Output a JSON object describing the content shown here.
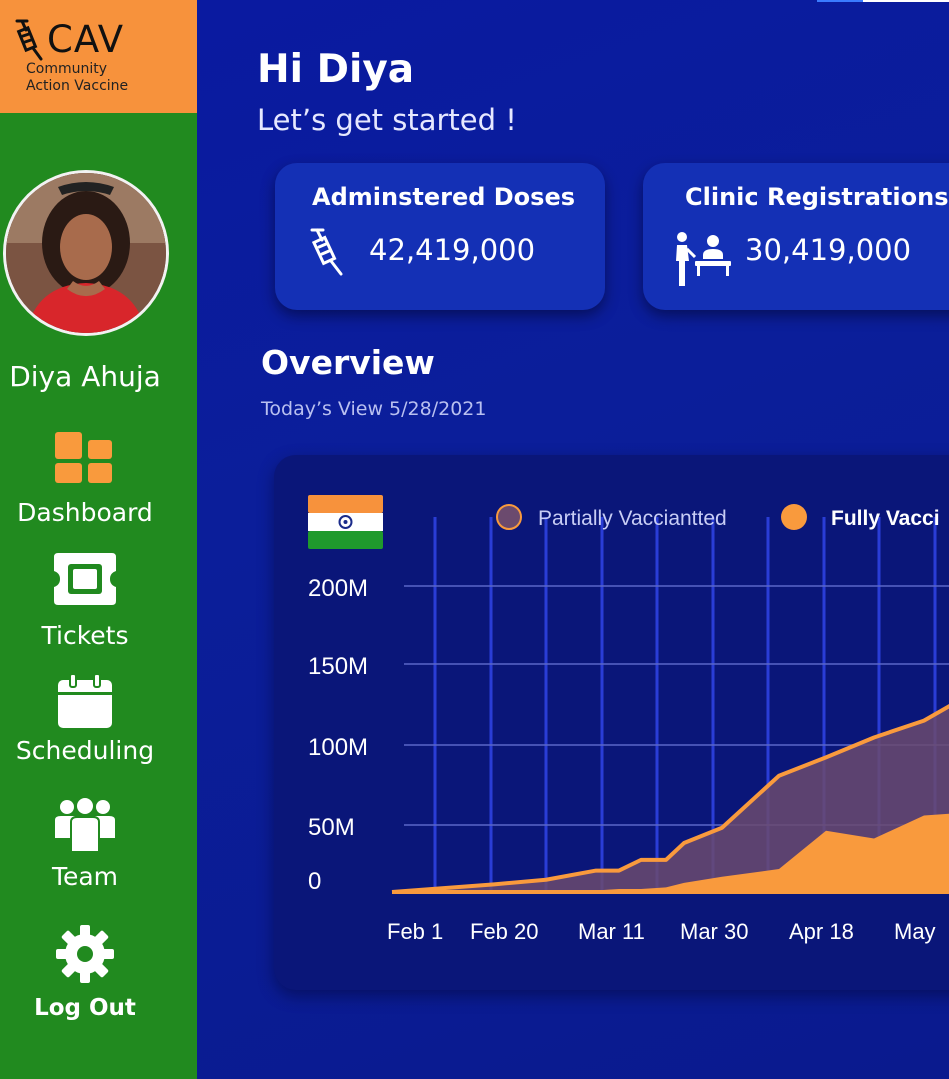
{
  "brand": {
    "logo_text": "CAV",
    "tagline_line1": "Community",
    "tagline_line2": "Action Vaccine",
    "icon": "syringe-icon"
  },
  "user": {
    "name": "Diya Ahuja"
  },
  "nav": [
    {
      "label": "Dashboard",
      "icon": "grid-icon"
    },
    {
      "label": "Tickets",
      "icon": "ticket-icon"
    },
    {
      "label": "Scheduling",
      "icon": "calendar-icon"
    },
    {
      "label": "Team",
      "icon": "team-icon"
    },
    {
      "label": "Log Out",
      "icon": "gear-icon"
    }
  ],
  "header": {
    "greeting": "Hi Diya",
    "subtitle": "Let’s get started !"
  },
  "cards": [
    {
      "title": "Adminstered Doses",
      "value": "42,419,000",
      "icon": "syringe-icon"
    },
    {
      "title": "Clinic Registrations",
      "value": "30,419,000",
      "icon": "clinic-icon"
    }
  ],
  "overview": {
    "title": "Overview",
    "subtitle": "Today’s View 5/28/2021"
  },
  "colors": {
    "sidebar": "#218a1f",
    "brand": "#f7923c",
    "accent": "#f99a3d",
    "partial_fill": "#6b4a6e"
  },
  "chart_data": {
    "type": "area",
    "country_flag": "india-flag-icon",
    "legend": [
      "Partially Vacciantted",
      "Fully Vacci"
    ],
    "x_ticks": [
      "Feb 1",
      "Feb 20",
      "Mar 11",
      "Mar 30",
      "Apr 18",
      "May"
    ],
    "y_ticks": [
      "0",
      "50M",
      "100M",
      "150M",
      "200M"
    ],
    "ylim": [
      0,
      200
    ],
    "y_unit": "M",
    "x": [
      "Feb 1",
      "Feb 20",
      "Mar 1",
      "Mar 11",
      "Mar 16",
      "Mar 22",
      "Mar 25",
      "Mar 30",
      "Apr 5",
      "Apr 18",
      "Apr 25",
      "May 1",
      "May 6"
    ],
    "series": [
      {
        "name": "Partially Vacciantted",
        "values": [
          0,
          5,
          8,
          14,
          14,
          21,
          21,
          32,
          42,
          76,
          88,
          101,
          112
        ]
      },
      {
        "name": "Fully Vacci",
        "values": [
          0,
          0,
          1,
          1,
          2,
          2,
          3,
          6,
          10,
          15,
          40,
          35,
          50
        ]
      }
    ]
  }
}
